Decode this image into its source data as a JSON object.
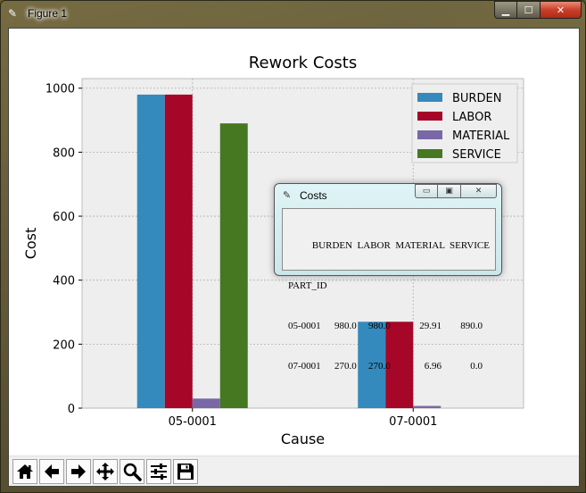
{
  "window": {
    "title": "Figure 1",
    "minimize_glyph": "▁",
    "maximize_glyph": "☐",
    "close_glyph": "✕"
  },
  "toolbar": {
    "buttons": [
      {
        "name": "home-icon"
      },
      {
        "name": "back-arrow-icon"
      },
      {
        "name": "forward-arrow-icon"
      },
      {
        "name": "pan-icon"
      },
      {
        "name": "zoom-icon"
      },
      {
        "name": "configure-subplots-icon"
      },
      {
        "name": "save-icon"
      }
    ]
  },
  "chart_data": {
    "type": "bar",
    "title": "Rework Costs",
    "xlabel": "Cause",
    "ylabel": "Cost",
    "categories": [
      "05-0001",
      "07-0001"
    ],
    "series": [
      {
        "name": "BURDEN",
        "values": [
          980.0,
          270.0
        ],
        "color": "#348abd"
      },
      {
        "name": "LABOR",
        "values": [
          980.0,
          270.0
        ],
        "color": "#a60628"
      },
      {
        "name": "MATERIAL",
        "values": [
          29.91,
          6.96
        ],
        "color": "#7a68a6"
      },
      {
        "name": "SERVICE",
        "values": [
          890.0,
          0.0
        ],
        "color": "#467821"
      }
    ],
    "ylim": [
      0,
      1030
    ],
    "yticks": [
      0,
      200,
      400,
      600,
      800,
      1000
    ],
    "grid": true,
    "legend_position": "top-right",
    "plot_background": "#eeeeee"
  },
  "popup": {
    "title": "Costs",
    "header": "BURDEN  LABOR  MATERIAL  SERVICE",
    "index_name": "PART_ID",
    "rows": [
      {
        "part": "05-0001",
        "burden": "980.0",
        "labor": "980.0",
        "material": "29.91",
        "service": "890.0"
      },
      {
        "part": "07-0001",
        "burden": "270.0",
        "labor": "270.0",
        "material": "6.96",
        "service": "0.0"
      }
    ]
  }
}
